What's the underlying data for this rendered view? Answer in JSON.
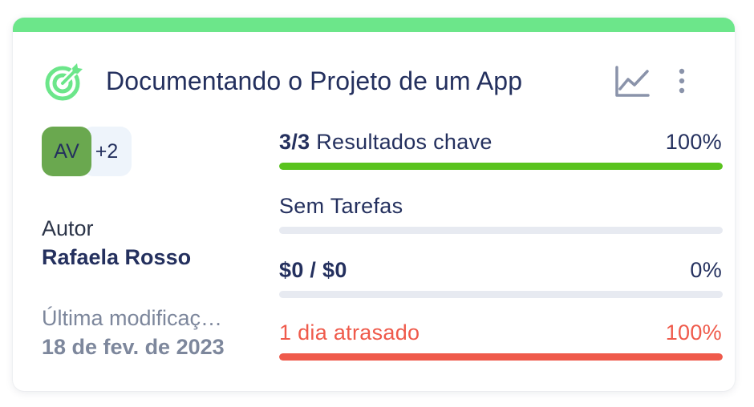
{
  "colors": {
    "accent_green": "#6ce68a",
    "avatar_green": "#6aa84f",
    "avatar_more_bg": "#eef4fb",
    "title": "#24305e",
    "text_body": "#2b3448",
    "text_muted": "#7d879c",
    "icon_gray": "#8a93aa",
    "bar_track": "#e7eaf1",
    "bar_success": "#5ac31e",
    "late_red": "#ef5a4b"
  },
  "header": {
    "icon": "target-icon",
    "title": "Documentando o Projeto de um App",
    "actions": [
      {
        "icon": "line-chart-icon"
      },
      {
        "icon": "more-vertical-icon"
      }
    ]
  },
  "members": {
    "primary_initials": "AV",
    "more_count": "+2"
  },
  "author": {
    "label": "Autor",
    "name": "Rafaela Rosso"
  },
  "modified": {
    "label": "Última modificaç…",
    "date": "18 de fev. de 2023"
  },
  "metrics": {
    "key_results": {
      "count": "3/3",
      "label": "Resultados chave",
      "percent": "100%",
      "progress": 1.0
    },
    "tasks": {
      "label": "Sem Tarefas",
      "progress": 0
    },
    "budget": {
      "label": "$0 / $0",
      "percent": "0%",
      "progress": 0
    },
    "deadline": {
      "label": "1 dia atrasado",
      "percent": "100%",
      "progress": 1.0
    }
  }
}
